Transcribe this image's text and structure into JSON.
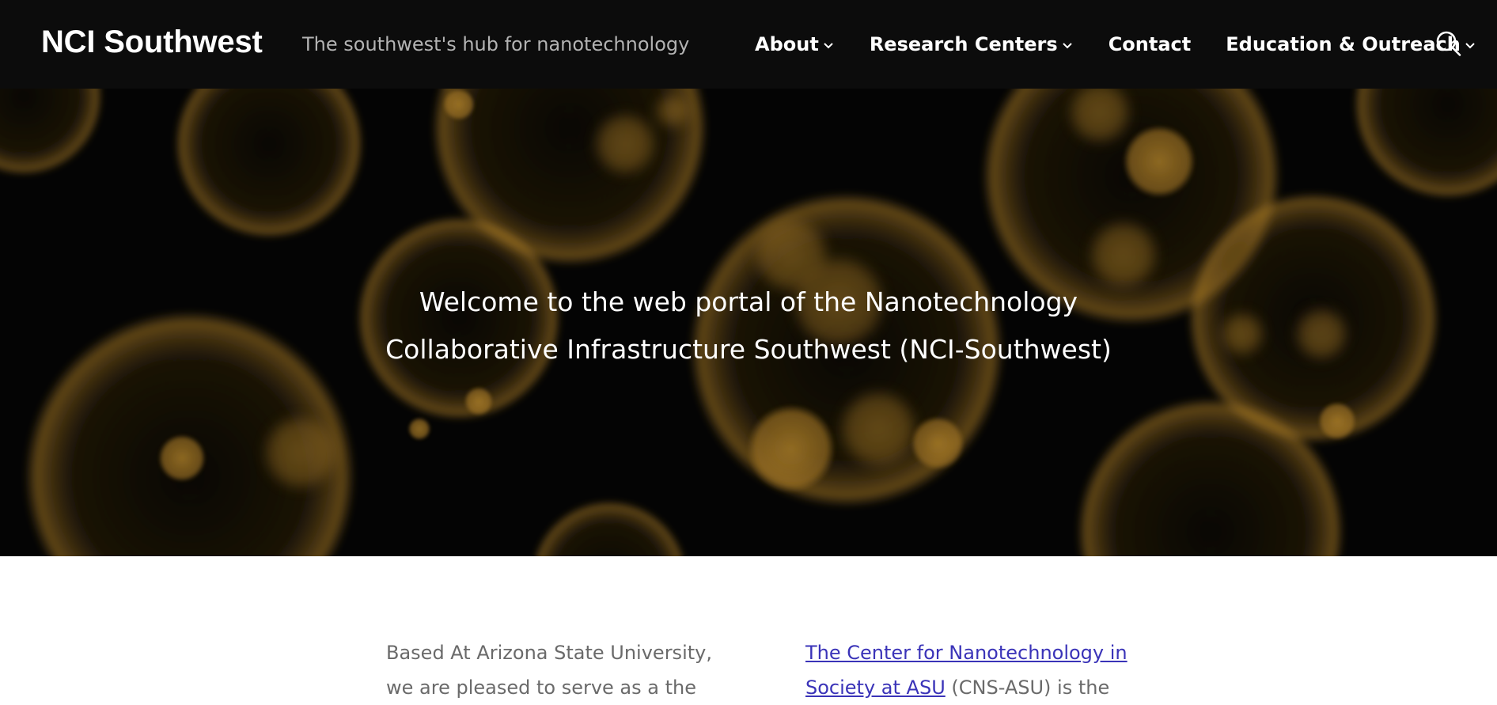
{
  "header": {
    "site_title": "NCI Southwest",
    "tagline": "The southwest's hub for nanotechnology",
    "nav": [
      {
        "label": "About",
        "has_dropdown": true
      },
      {
        "label": "Research Centers",
        "has_dropdown": true
      },
      {
        "label": "Contact",
        "has_dropdown": false
      },
      {
        "label": "Education & Outreach",
        "has_dropdown": true
      }
    ],
    "search_icon": "search-icon"
  },
  "hero": {
    "line1": "Welcome to the web portal of the Nanotechnology",
    "line2": "Collaborative Infrastructure Southwest (NCI-Southwest)"
  },
  "content": {
    "left": {
      "line1": "Based At Arizona State University,",
      "line2": "we are pleased to serve as a the"
    },
    "right": {
      "link_line1": "The Center for Nanotechnology in",
      "link_line2": "Society at ASU",
      "line2_rest": " (CNS-ASU) is the"
    }
  },
  "colors": {
    "header_bg": "#0c0c0c",
    "hero_bg": "#040404",
    "accent_gold": "#b8862a",
    "link": "#3a33b8",
    "body_text": "#6a6a6a"
  }
}
